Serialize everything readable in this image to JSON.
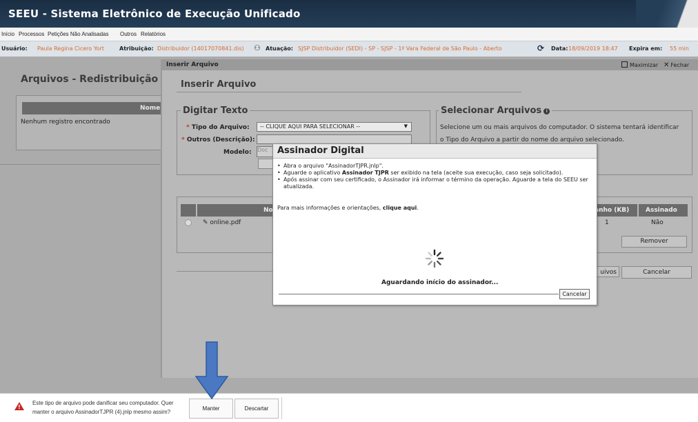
{
  "app": {
    "title": "SEEU - Sistema Eletrônico de Execução Unificado"
  },
  "menu": [
    "Início",
    "Processos",
    "Petições Não Analisadas",
    "Outros",
    "Relatórios"
  ],
  "userbar": {
    "usuario_label": "Usuário:",
    "usuario": "Paula Regina Cicero Yort",
    "atribuicao_label": "Atribuição:",
    "atribuicao": "Distribuidor (14017070841.dis)",
    "atuacao_label": "Atuação:",
    "atuacao": "SJSP Distribuidor (SEDI) - SP - SJSP - 1ª Vara Federal de São Paulo - Aberto",
    "data_label": "Data:",
    "data": "18/09/2019 18:47",
    "expira_label": "Expira em:",
    "expira": "55 min"
  },
  "page": {
    "title": "Arquivos - Redistribuição",
    "col_nome": "Nome",
    "empty": "Nenhum registro encontrado"
  },
  "dialog": {
    "bar_title": "Inserir Arquivo",
    "maximizar": "Maximizar",
    "fechar": "Fechar",
    "heading": "Inserir Arquivo",
    "digitar": {
      "legend": "Digitar Texto",
      "tipo_label": "Tipo do Arquivo:",
      "tipo_value": "-- CLIQUE AQUI PARA SELECIONAR --",
      "outros_label": "Outros (Descrição):",
      "modelo_label": "Modelo:",
      "modelo_value": "Doc",
      "req": "*"
    },
    "selecionar": {
      "legend": "Selecionar Arquivos",
      "info_icon": "i",
      "text": "Selecione um ou mais arquivos do computador. O sistema tentará identificar o Tipo do Arquivo a partir do nome do arquivo selecionado."
    },
    "files": {
      "col_nome": "Nome",
      "col_tam": "Tamanho (KB)",
      "col_tam_visible": "anho (KB)",
      "col_ass": "Assinado",
      "rows": [
        {
          "name": "online.pdf",
          "icon": "✎",
          "size": "1",
          "assinado": "Não"
        }
      ],
      "remover": "Remover"
    },
    "btn_arquivos": "uivos",
    "btn_cancelar": "Cancelar"
  },
  "assinador": {
    "title": "Assinador Digital",
    "items": [
      "Abra o arquivo \"AssinadorTJPR.jnlp\".",
      "Aguarde o aplicativo Assinador TJPR ser exibido na tela (aceite sua execução, caso seja solicitado).",
      "Após assinar com seu certificado, o Assinador irá informar o término da operação. Aguarde a tela do SEEU ser atualizada."
    ],
    "more_prefix": "Para mais informações e orientações, ",
    "more_link": "clique aqui",
    "more_suffix": ".",
    "waiting": "Aguardando início do assinador...",
    "cancel": "Cancelar"
  },
  "download": {
    "warning": "Este tipo de arquivo pode danificar seu computador. Quer manter o arquivo AssinadorTJPR (4).jnlp mesmo assim?",
    "manter": "Manter",
    "descartar": "Descartar"
  },
  "colors": {
    "header": "#1a2e43",
    "accent": "#d96b2e",
    "arrow": "#4a78c2",
    "danger": "#c62828"
  }
}
